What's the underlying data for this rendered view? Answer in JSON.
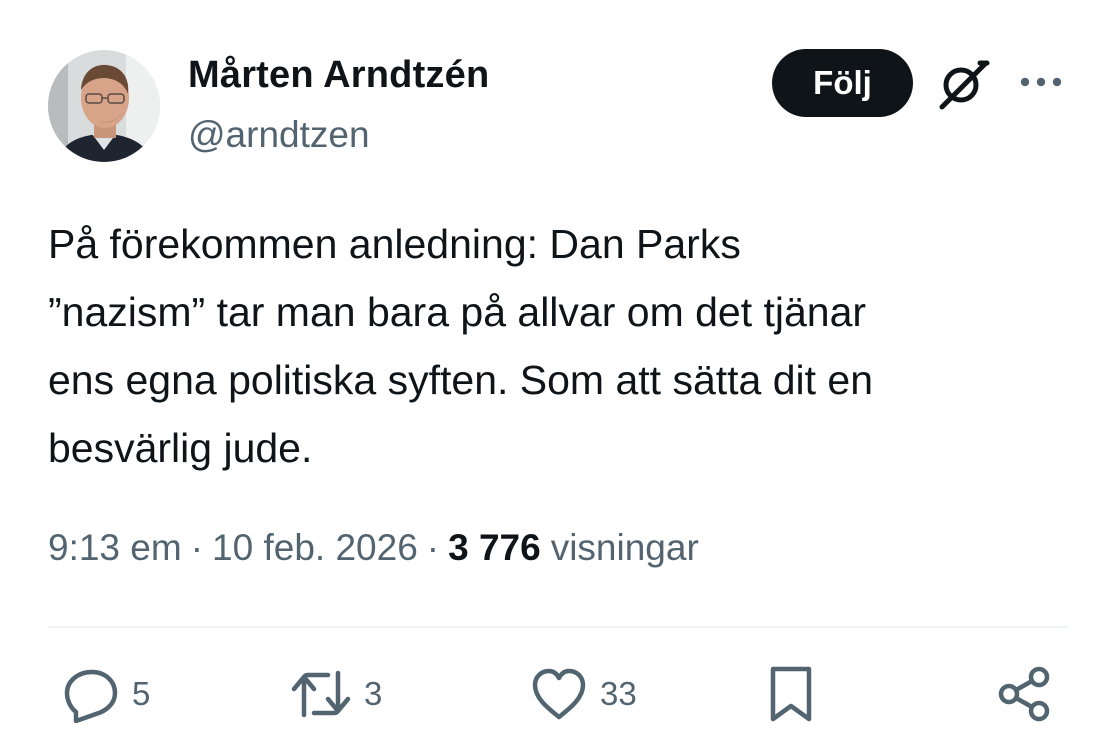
{
  "author": {
    "display_name": "Mårten Arndtzén",
    "handle": "@arndtzen"
  },
  "header": {
    "follow_label": "Följ",
    "grok_icon": "grok-icon",
    "more_icon": "more-horizontal-icon"
  },
  "tweet": {
    "text": "På förekommen anledning: Dan Parks\n”nazism” tar man bara på allvar om det tjänar\nens egna politiska syften. Som att sätta dit en\nbesvärlig jude."
  },
  "meta": {
    "time": "9:13 em",
    "separator": "·",
    "date": "10 feb. 2026",
    "views_count": "3 776",
    "views_label": "visningar"
  },
  "actions": {
    "replies": "5",
    "reposts": "3",
    "likes": "33",
    "icons": [
      "reply-icon",
      "repost-icon",
      "like-icon",
      "bookmark-icon",
      "share-icon"
    ]
  },
  "colors": {
    "text": "#0f1419",
    "secondary": "#536471",
    "follow_bg": "#0f1419",
    "divider": "#eff3f4"
  }
}
